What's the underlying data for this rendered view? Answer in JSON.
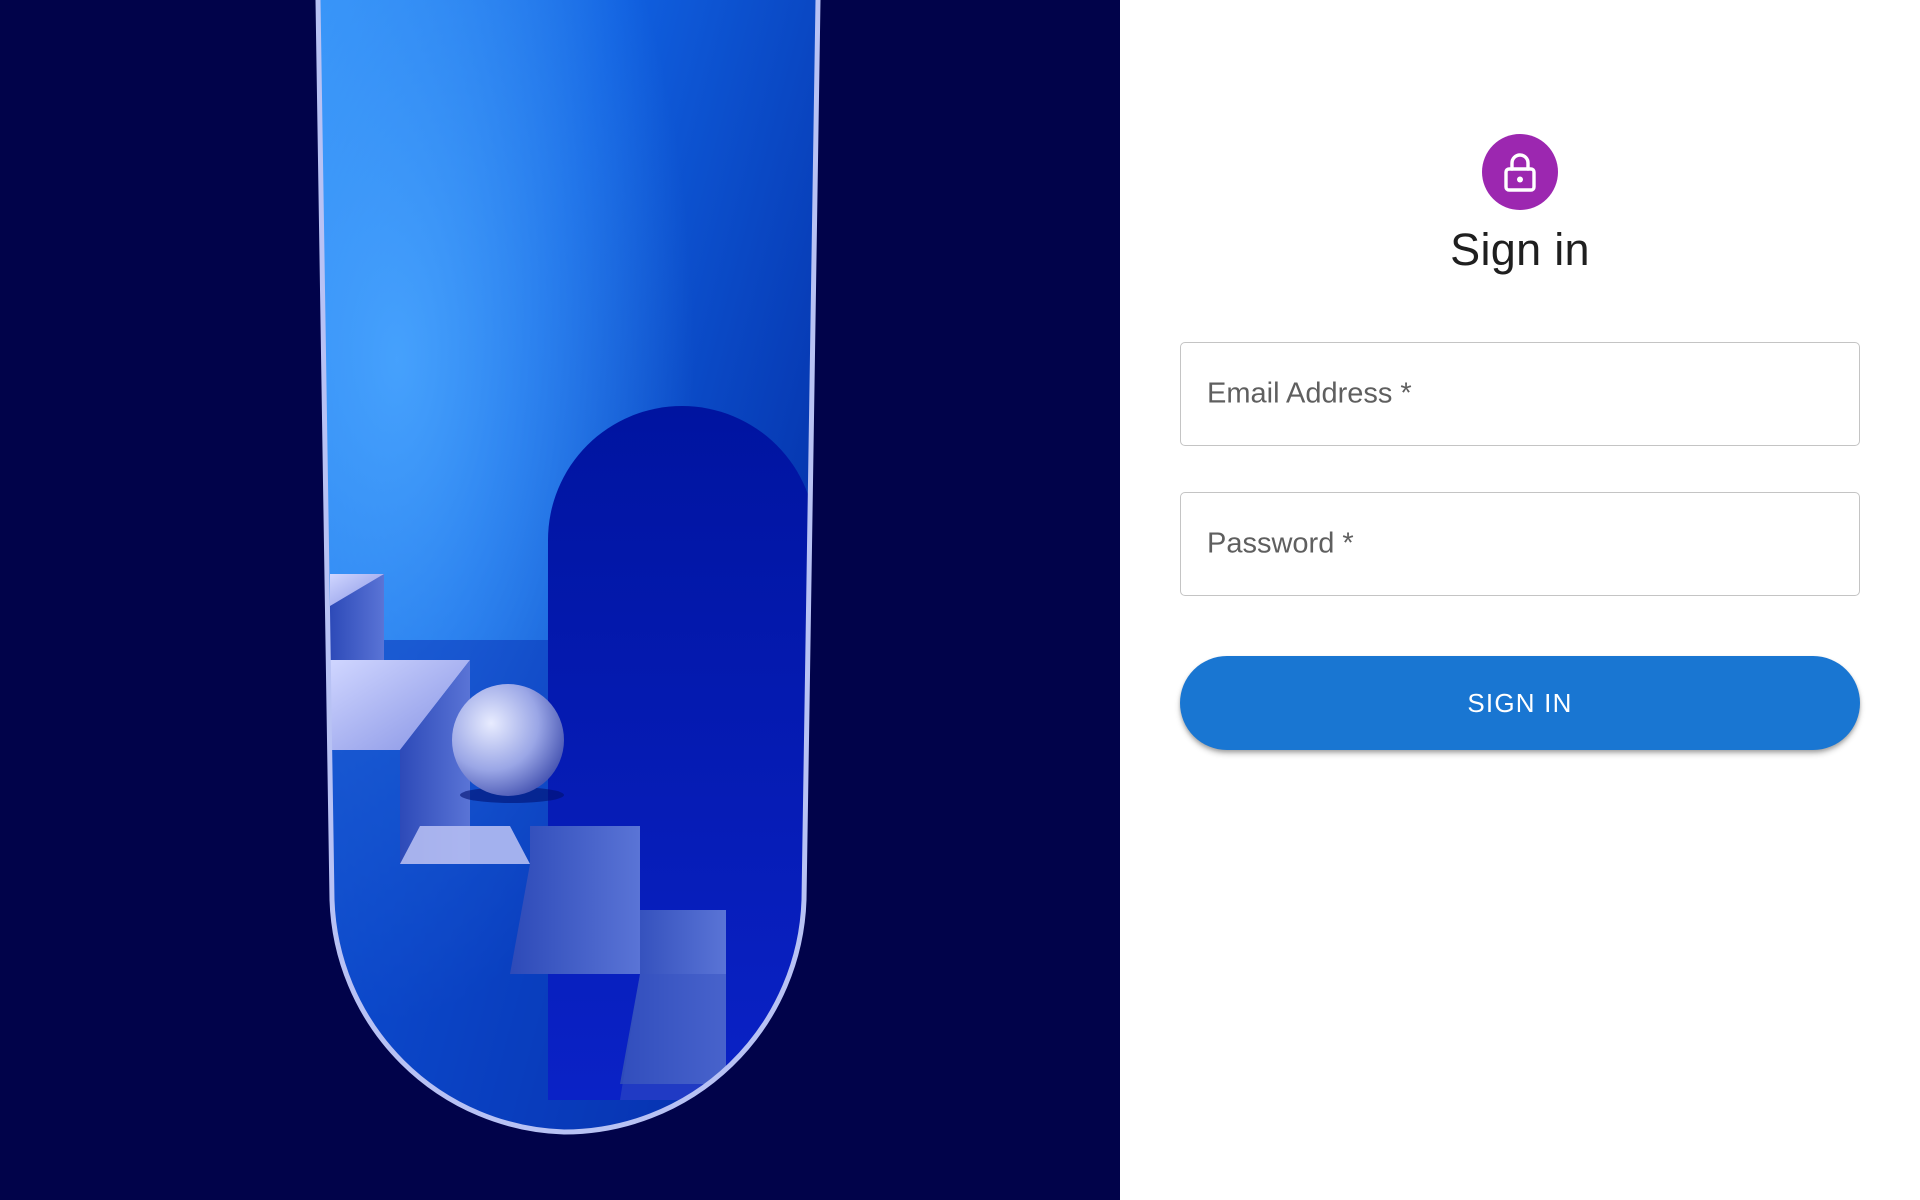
{
  "hero": {
    "icon": "abstract-stairs-sphere-illustration",
    "background_color": "#01034a"
  },
  "auth": {
    "avatar_icon": "lock-icon",
    "avatar_color": "#9c27b0",
    "title": "Sign in",
    "email": {
      "label": "Email Address *",
      "value": ""
    },
    "password": {
      "label": "Password *",
      "value": ""
    },
    "submit_label": "SIGN IN",
    "submit_color": "#1976d2"
  }
}
